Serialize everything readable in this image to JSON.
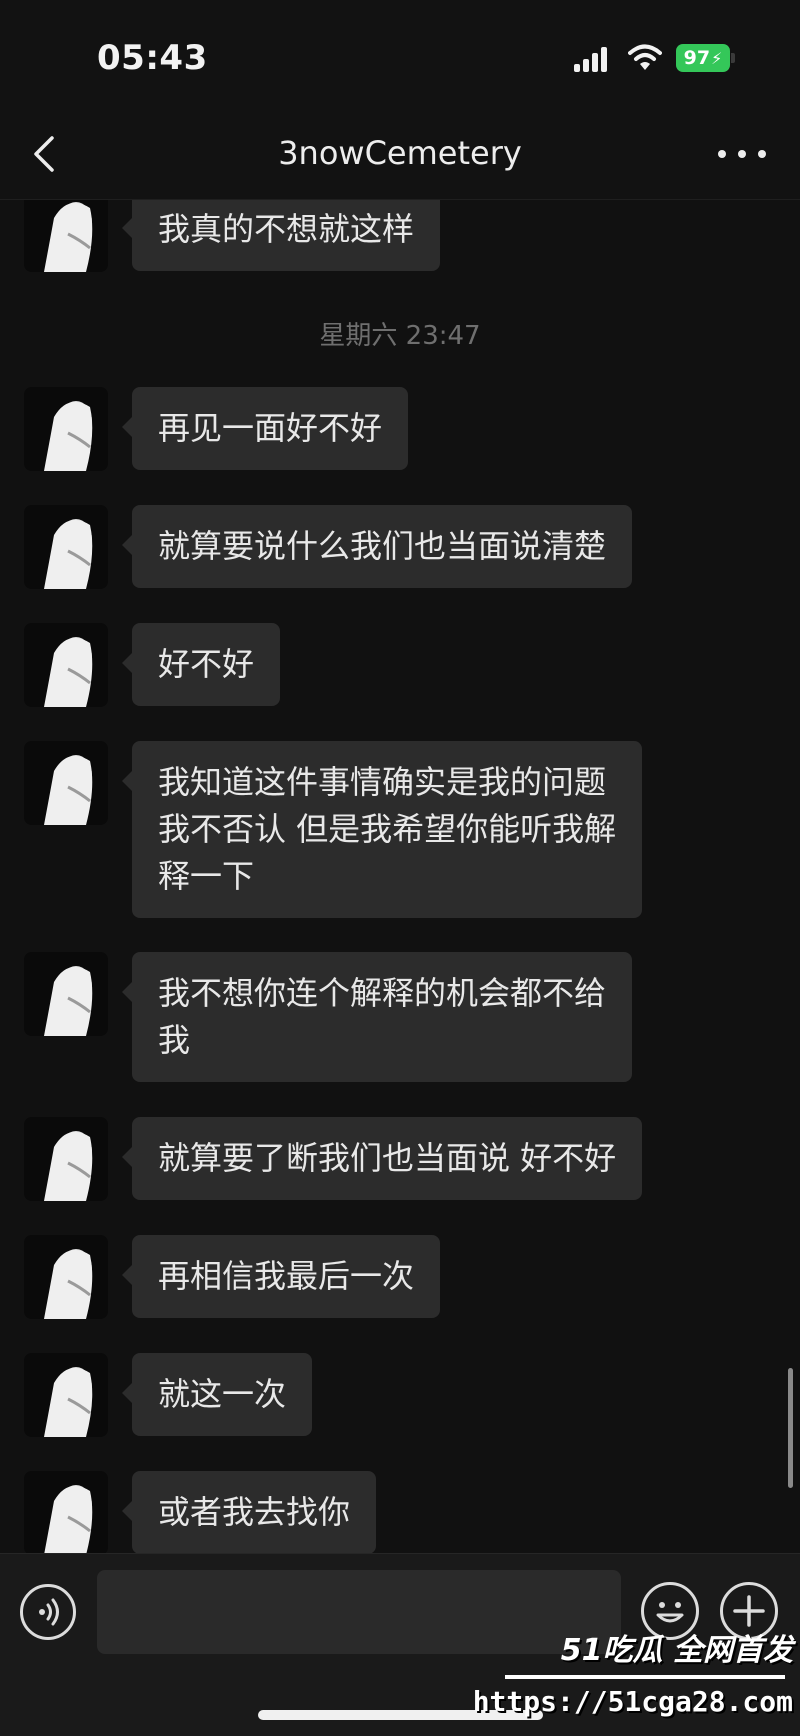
{
  "status_bar": {
    "time": "05:43",
    "battery": "97"
  },
  "nav": {
    "title": "3nowCemetery"
  },
  "chat": {
    "timestamp": "星期六 23:47",
    "messages": [
      {
        "text": "我真的不想就这样"
      },
      {
        "text": "再见一面好不好"
      },
      {
        "text": "就算要说什么我们也当面说清楚"
      },
      {
        "text": "好不好"
      },
      {
        "text": "我知道这件事情确实是我的问题\n我不否认 但是我希望你能听我解\n释一下"
      },
      {
        "text": "我不想你连个解释的机会都不给\n我"
      },
      {
        "text": "就算要了断我们也当面说 好不好"
      },
      {
        "text": "再相信我最后一次"
      },
      {
        "text": "就这一次"
      },
      {
        "text": "或者我去找你"
      }
    ]
  },
  "watermark": {
    "brand": "51吃瓜 全网首发",
    "url": "https://51cga28.com"
  },
  "colors": {
    "background": "#111111",
    "bubble": "#2c2c2c",
    "battery": "#34c759"
  }
}
